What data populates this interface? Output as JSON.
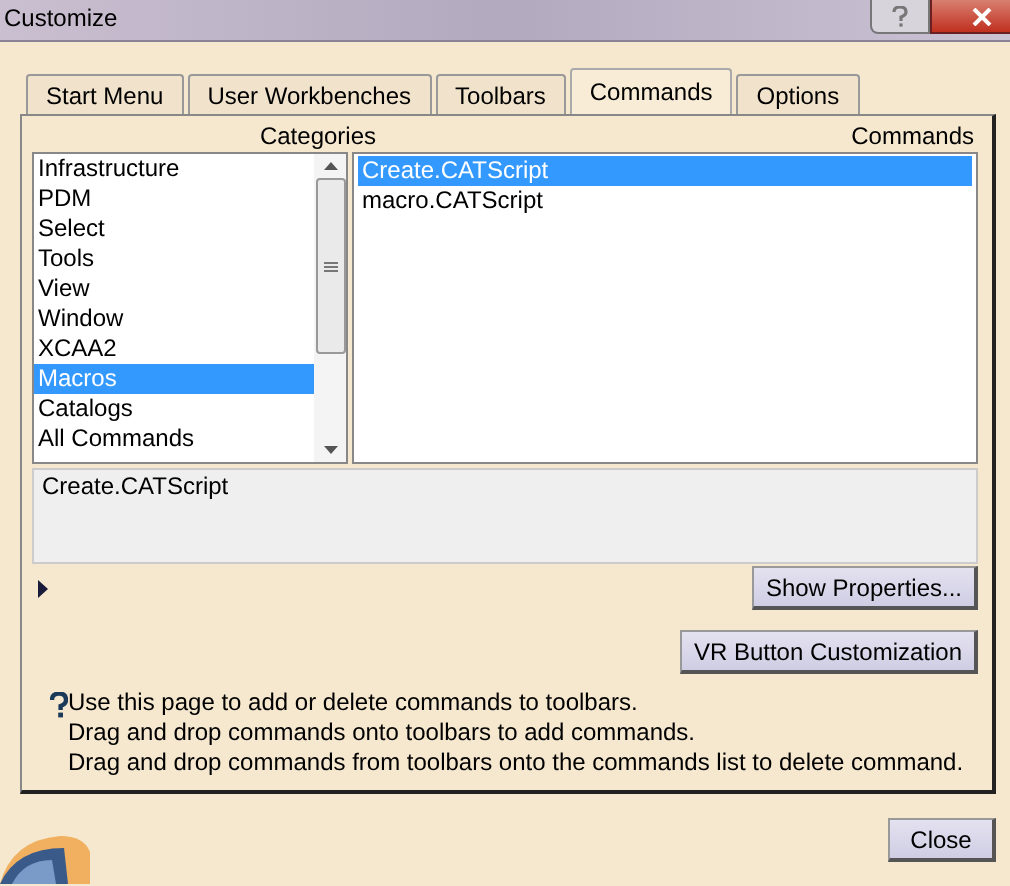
{
  "window": {
    "title": "Customize"
  },
  "tabs": [
    {
      "label": "Start Menu",
      "selected": false
    },
    {
      "label": "User Workbenches",
      "selected": false
    },
    {
      "label": "Toolbars",
      "selected": false
    },
    {
      "label": "Commands",
      "selected": true
    },
    {
      "label": "Options",
      "selected": false
    }
  ],
  "categories": {
    "heading": "Categories",
    "items": [
      {
        "label": "Infrastructure",
        "selected": false
      },
      {
        "label": "PDM",
        "selected": false
      },
      {
        "label": "Select",
        "selected": false
      },
      {
        "label": "Tools",
        "selected": false
      },
      {
        "label": "View",
        "selected": false
      },
      {
        "label": "Window",
        "selected": false
      },
      {
        "label": "XCAA2",
        "selected": false
      },
      {
        "label": "Macros",
        "selected": true
      },
      {
        "label": "Catalogs",
        "selected": false
      },
      {
        "label": "All Commands",
        "selected": false
      }
    ]
  },
  "commands": {
    "heading": "Commands",
    "items": [
      {
        "label": "Create.CATScript",
        "selected": true
      },
      {
        "label": "macro.CATScript",
        "selected": false
      }
    ]
  },
  "description": "Create.CATScript",
  "buttons": {
    "show_properties": "Show Properties...",
    "vr_customization": "VR Button Customization",
    "close": "Close"
  },
  "help_lines": [
    "Use this page to add or delete commands to toolbars.",
    "Drag and drop commands onto toolbars to add commands.",
    "Drag and drop commands from toolbars onto the commands list to delete command."
  ]
}
